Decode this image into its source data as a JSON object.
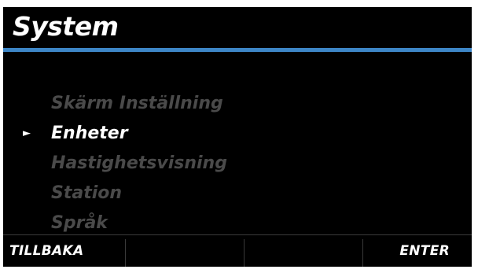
{
  "screen": {
    "title": "System"
  },
  "menu": {
    "selected_index": 1,
    "pointer_glyph": "►",
    "items": [
      {
        "label": "Skärm Inställning"
      },
      {
        "label": "Enheter"
      },
      {
        "label": "Hastighetsvisning"
      },
      {
        "label": "Station"
      },
      {
        "label": "Språk"
      }
    ]
  },
  "softkeys": {
    "back_label": "TILLBAKA",
    "soft2_label": "",
    "soft3_label": "",
    "enter_label": "ENTER"
  },
  "colors": {
    "header_rule": "#3d86c6",
    "active_text": "#ffffff",
    "inactive_text": "#4a4a4a",
    "background": "#000000"
  }
}
